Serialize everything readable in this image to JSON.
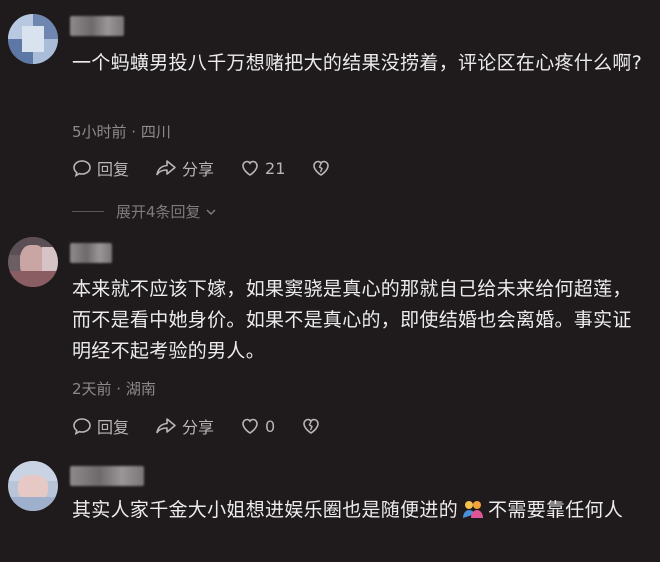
{
  "comments": [
    {
      "text": "一个蚂蟥男投八千万想赌把大的结果没捞着，评论区在心疼什么啊?",
      "time_location": "5小时前 · 四川",
      "reply_label": "回复",
      "share_label": "分享",
      "like_count": "21",
      "expand_label": "展开4条回复"
    },
    {
      "text": "本来就不应该下嫁，如果窦骁是真心的那就自己给未来给何超莲，而不是看中她身价。如果不是真心的，即使结婚也会离婚。事实证明经不起考验的男人。",
      "time_location": "2天前 · 湖南",
      "reply_label": "回复",
      "share_label": "分享",
      "like_count": "0"
    },
    {
      "text_before_emoji": "其实人家千金大小姐想进娱乐圈也是随便进的",
      "text_after_emoji": "不需要靠任何人",
      "emoji": "people-hugging-emoji"
    }
  ],
  "colors": {
    "background": "#1f1a1c",
    "text": "#ececec",
    "meta": "#8d8a8b",
    "action": "#b9b6b7"
  }
}
